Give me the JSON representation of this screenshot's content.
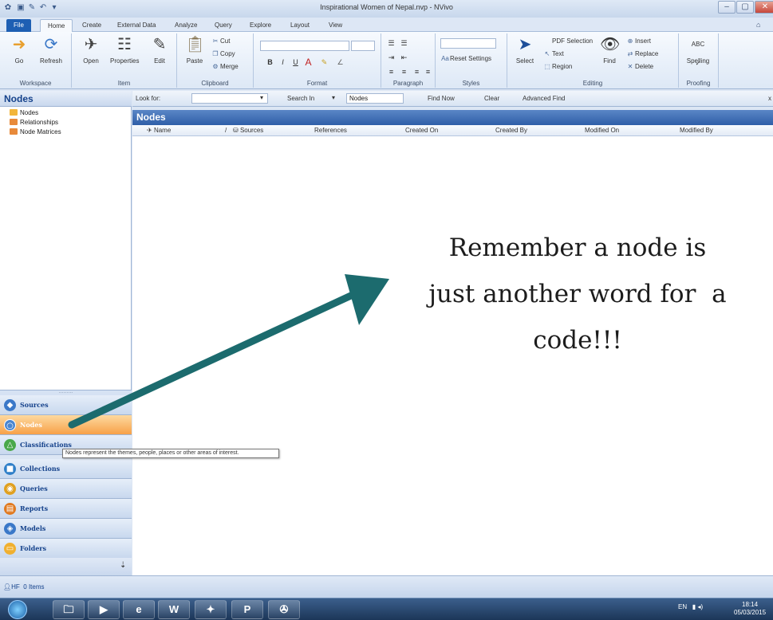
{
  "window": {
    "title": "Inspirational Women of Nepal.nvp - NVivo",
    "controls": {
      "minimize": "–",
      "maximize": "▢",
      "close": "✕"
    }
  },
  "ribbon": {
    "tabs": [
      "File",
      "Home",
      "Create",
      "External Data",
      "Analyze",
      "Query",
      "Explore",
      "Layout",
      "View"
    ],
    "active_tab": "Home",
    "workspace": {
      "go": "Go",
      "refresh": "Refresh",
      "label": "Workspace"
    },
    "item": {
      "open": "Open",
      "properties": "Properties",
      "edit": "Edit",
      "label": "Item"
    },
    "clipboard": {
      "paste": "Paste",
      "cut": "Cut",
      "copy": "Copy",
      "merge": "Merge",
      "label": "Clipboard"
    },
    "format": {
      "bold": "B",
      "italic": "I",
      "underline": "U",
      "font_color": "A",
      "label": "Format"
    },
    "paragraph": {
      "label": "Paragraph"
    },
    "styles": {
      "reset": "Reset Settings",
      "label": "Styles"
    },
    "editing": {
      "select": "Select",
      "pdf_selection": "PDF Selection",
      "text": "Text",
      "region": "Region",
      "find": "Find",
      "insert": "Insert",
      "replace": "Replace",
      "delete": "Delete",
      "label": "Editing"
    },
    "proofing": {
      "spelling": "Spelling",
      "abc": "ABC",
      "label": "Proofing"
    }
  },
  "nav": {
    "header": "Nodes",
    "tree": [
      {
        "label": "Nodes",
        "color": "#f2b53a"
      },
      {
        "label": "Relationships",
        "color": "#e88a3a"
      },
      {
        "label": "Node Matrices",
        "color": "#e88a3a"
      }
    ],
    "buttons": [
      {
        "label": "Sources",
        "color": "#3a78c8",
        "icon": "◆"
      },
      {
        "label": "Nodes",
        "color": "#ffffff",
        "icon": "○"
      },
      {
        "label": "Classifications",
        "color": "#4aa84a",
        "icon": "△"
      },
      {
        "label": "Collections",
        "color": "#2f7fc8",
        "icon": "■"
      },
      {
        "label": "Queries",
        "color": "#e0a020",
        "icon": "◉"
      },
      {
        "label": "Reports",
        "color": "#e07a20",
        "icon": "▤"
      },
      {
        "label": "Models",
        "color": "#3a78c8",
        "icon": "◈"
      },
      {
        "label": "Folders",
        "color": "#f0b030",
        "icon": "▭"
      }
    ],
    "selected": "Nodes"
  },
  "findbar": {
    "look_for_label": "Look for:",
    "look_for_value": "",
    "search_in_label": "Search In",
    "search_in_value": "Nodes",
    "find_now": "Find Now",
    "clear": "Clear",
    "advanced_find": "Advanced Find",
    "close": "x"
  },
  "list": {
    "title": "Nodes",
    "columns": [
      "Name",
      "Sources",
      "References",
      "Created On",
      "Created By",
      "Modified On",
      "Modified By"
    ]
  },
  "tooltip": "Nodes represent the themes, people, places or other areas of interest.",
  "status": {
    "user": "HF",
    "items": "0 Items"
  },
  "taskbar": {
    "apps": [
      "🗀",
      "▶",
      "e",
      "W",
      "✦",
      "P",
      "✇"
    ],
    "tray_lang": "EN",
    "time": "18:14",
    "date": "05/03/2015"
  },
  "annotation": {
    "lines": [
      "Remember a node is",
      "just another word for  a",
      "code!!!"
    ],
    "arrow_color": "#1c6b6e"
  }
}
